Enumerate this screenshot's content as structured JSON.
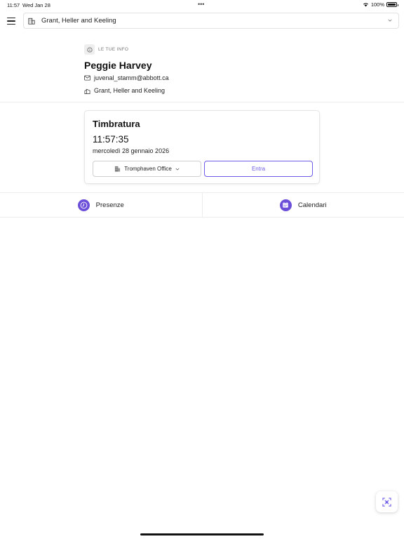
{
  "status_bar": {
    "time": "11:57",
    "date": "Wed Jan 28",
    "dots": "•••",
    "battery": "100%",
    "wifi_icon": "wifi-icon",
    "battery_icon": "battery-icon"
  },
  "header": {
    "menu_icon": "hamburger-menu-icon",
    "org_icon": "building-icon",
    "org_name": "Grant, Heller and Keeling",
    "chevron_icon": "chevron-down-icon"
  },
  "profile": {
    "section_label": "LE TUE INFO",
    "section_icon": "info-icon",
    "name": "Peggie Harvey",
    "email": "juvenal_stamm@abbott.ca",
    "email_icon": "mail-icon",
    "company": "Grant, Heller and Keeling",
    "company_icon": "company-icon"
  },
  "clock_card": {
    "title": "Timbratura",
    "time": "11:57:35",
    "date": "mercoledì 28 gennaio 2026",
    "office_label": "Tromphaven Office",
    "office_icon": "office-building-icon",
    "enter_label": "Entra"
  },
  "tabs": [
    {
      "label": "Presenze",
      "icon": "clock-icon"
    },
    {
      "label": "Calendari",
      "icon": "calendar-icon"
    }
  ],
  "fab": {
    "icon": "qr-scan-icon"
  },
  "colors": {
    "accent": "#6c5ce7",
    "tab_icon_bg": "#6c4fd8",
    "border": "#e2e2e2"
  }
}
